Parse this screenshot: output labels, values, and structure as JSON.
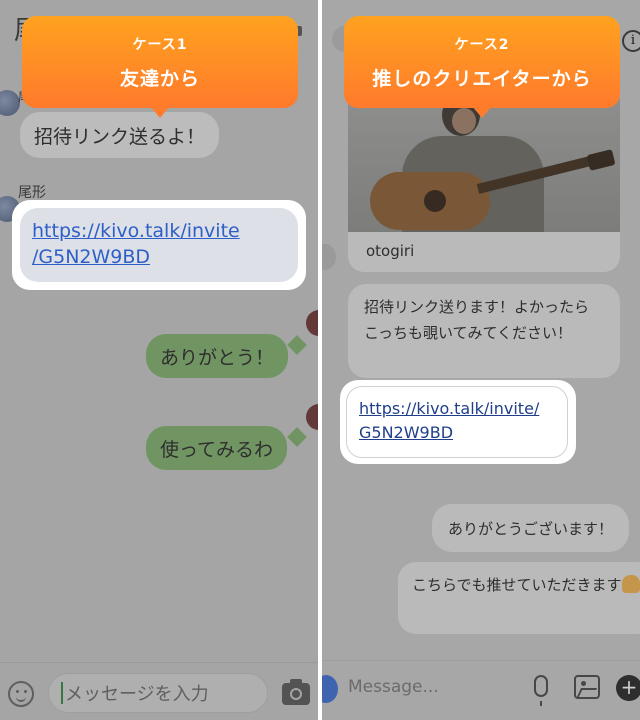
{
  "left_panel": {
    "callout": {
      "case_label": "ケース1",
      "title": "友達から"
    },
    "header_title_partial": "尾",
    "messages": {
      "partial_sender": "尾",
      "msg1": "招待リンク送るよ！",
      "sender_name": "尾形",
      "link": "https://kivo.talk/invite\n/G5N2W9BD",
      "reply1": "ありがとう！",
      "reply2": "使ってみるわ"
    },
    "composer": {
      "placeholder": "メッセージを入力"
    }
  },
  "right_panel": {
    "callout": {
      "case_label": "ケース2",
      "title": "推しのクリエイターから"
    },
    "info_glyph": "i",
    "post": {
      "caption": "otogiri"
    },
    "messages": {
      "msg1": "招待リンク送ります！よかったらこっちも覗いてみてください！",
      "link": "https://kivo.talk/invite/\nG5N2W9BD",
      "reply1": "ありがとうございます！",
      "reply2": "こちらでも推せていただきます"
    },
    "composer": {
      "placeholder": "Message..."
    },
    "plus_glyph": "+"
  },
  "colors": {
    "callout_gradient_top": "#ffa21f",
    "callout_gradient_bottom": "#ff7a2c",
    "link_blue_left": "#2e5fc8",
    "link_blue_right": "#1f3f8a",
    "reply_green": "#7fb06a"
  }
}
